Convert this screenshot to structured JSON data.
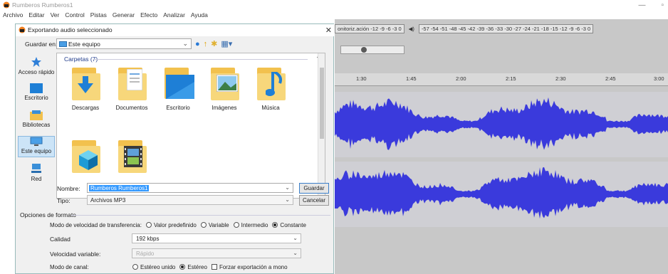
{
  "app": {
    "title": "Rumberos Rumberos1",
    "menu": [
      "Archivo",
      "Editar",
      "Ver",
      "Control",
      "Pistas",
      "Generar",
      "Efecto",
      "Analizar",
      "Ayuda"
    ]
  },
  "audacity": {
    "monitor_label": "onitoriz.ación",
    "rec_meter": "-12 -9 -6 -3 0",
    "play_meter": "-57 -54 -51 -48 -45 -42 -39 -36 -33 -30 -27 -24 -21 -18 -15 -12 -9 -6 -3 0",
    "ruler_ticks": [
      "1:30",
      "1:45",
      "2:00",
      "2:15",
      "2:30",
      "2:45",
      "3:00"
    ]
  },
  "dialog": {
    "title": "Exportando audio seleccionado",
    "save_in_label": "Guardar en:",
    "save_in_value": "Este equipo",
    "places": [
      "Acceso rápido",
      "Escritorio",
      "Bibliotecas",
      "Este equipo",
      "Red"
    ],
    "group_header": "Carpetas (7)",
    "folders": [
      "Descargas",
      "Documentos",
      "Escritorio",
      "Imágenes",
      "Música",
      "",
      ""
    ],
    "name_label": "Nombre:",
    "name_value": "Rumberos Rumberos1",
    "type_label": "Tipo:",
    "type_value": "Archivos MP3",
    "save_button": "Guardar",
    "cancel_button": "Cancelar",
    "format": {
      "title": "Opciones de formato",
      "bitrate_mode_label": "Modo de velocidad de transferencia:",
      "bitrate_modes": [
        "Valor predefinido",
        "Variable",
        "Intermedio",
        "Constante"
      ],
      "bitrate_selected": "Constante",
      "quality_label": "Calidad",
      "quality_value": "192 kbps",
      "variable_speed_label": "Velocidad variable:",
      "variable_speed_value": "Rápido",
      "channel_mode_label": "Modo de canal:",
      "channel_modes": [
        "Estéreo unido",
        "Estéreo"
      ],
      "channel_selected": "Estéreo",
      "force_mono_label": "Forzar exportación a mono"
    }
  },
  "colors": {
    "waveform": "#3a3adc",
    "selection_blue": "#3399ff",
    "folder": "#f2c14e"
  }
}
